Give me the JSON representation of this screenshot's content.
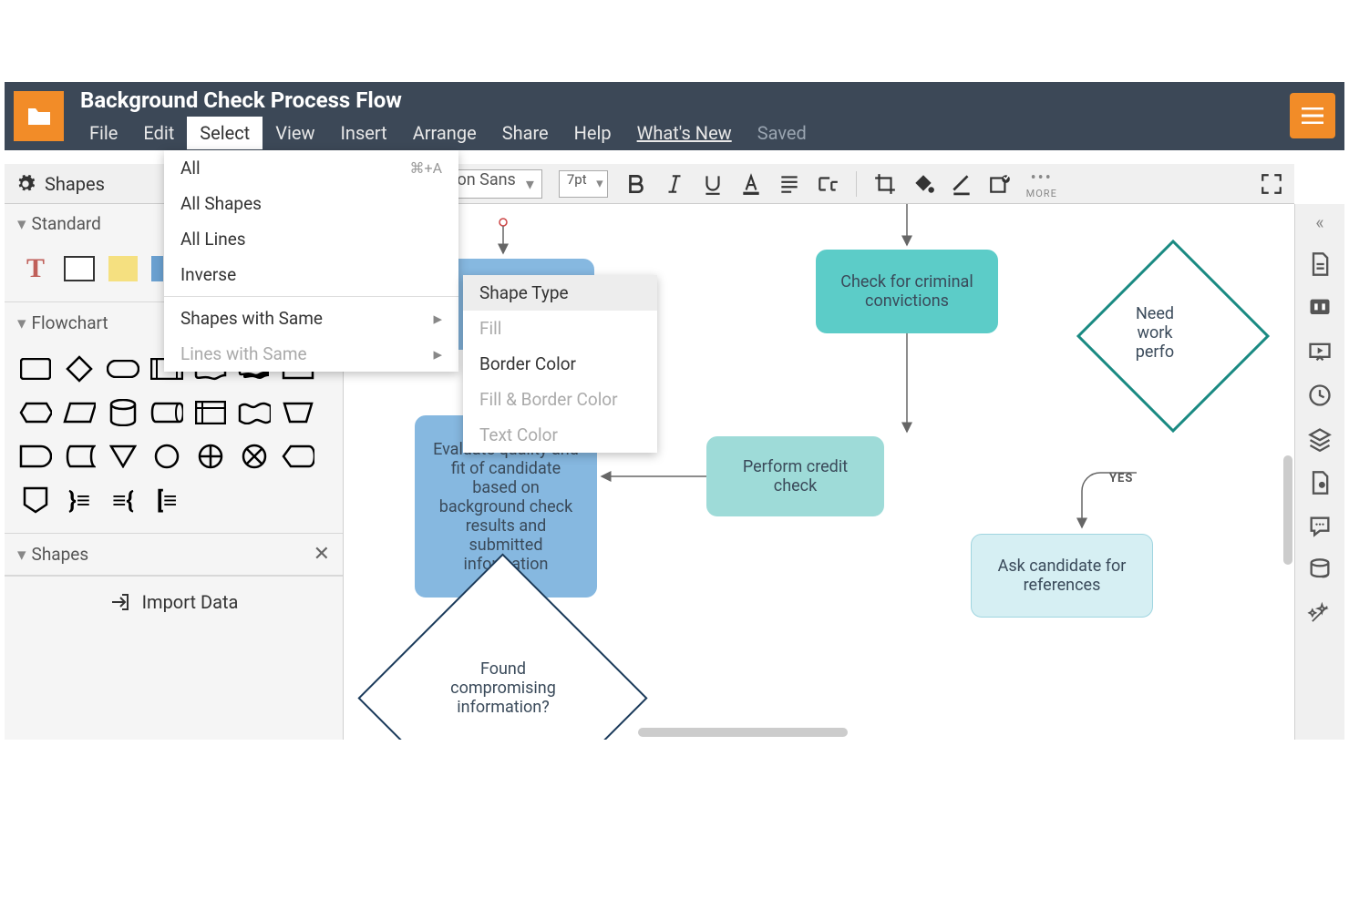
{
  "header": {
    "doc_title": "Background Check Process Flow",
    "menus": [
      "File",
      "Edit",
      "Select",
      "View",
      "Insert",
      "Arrange",
      "Share",
      "Help",
      "What's New",
      "Saved"
    ]
  },
  "toolbar": {
    "shapes_label": "Shapes",
    "font": "Liberation Sans",
    "font_size": "7pt",
    "more_label": "MORE"
  },
  "left_panel": {
    "sections": {
      "standard": "Standard",
      "flowchart": "Flowchart",
      "shapes": "Shapes"
    },
    "import_label": "Import Data"
  },
  "select_menu": {
    "items": [
      {
        "label": "All",
        "shortcut": "⌘+A",
        "enabled": true
      },
      {
        "label": "All Shapes",
        "enabled": true
      },
      {
        "label": "All Lines",
        "enabled": true
      },
      {
        "label": "Inverse",
        "enabled": true
      }
    ],
    "items2": [
      {
        "label": "Shapes with Same",
        "enabled": true,
        "submenu": true
      },
      {
        "label": "Lines with Same",
        "enabled": false,
        "submenu": true
      }
    ]
  },
  "submenu": {
    "items": [
      {
        "label": "Shape Type",
        "enabled": true,
        "hover": true
      },
      {
        "label": "Fill",
        "enabled": false
      },
      {
        "label": "Border Color",
        "enabled": true
      },
      {
        "label": "Fill & Border Color",
        "enabled": false
      },
      {
        "label": "Text Color",
        "enabled": false
      }
    ]
  },
  "canvas": {
    "nodes": {
      "evaluate": "Evaluate quality and fit of candidate based on background check results and submitted information",
      "criminal": "Check for criminal convictions",
      "credit": "Perform credit check",
      "references": "Ask candidate for references",
      "need_work": "Need work perfo",
      "found_compromising": "Found compromising information?"
    },
    "labels": {
      "yes": "YES"
    }
  }
}
